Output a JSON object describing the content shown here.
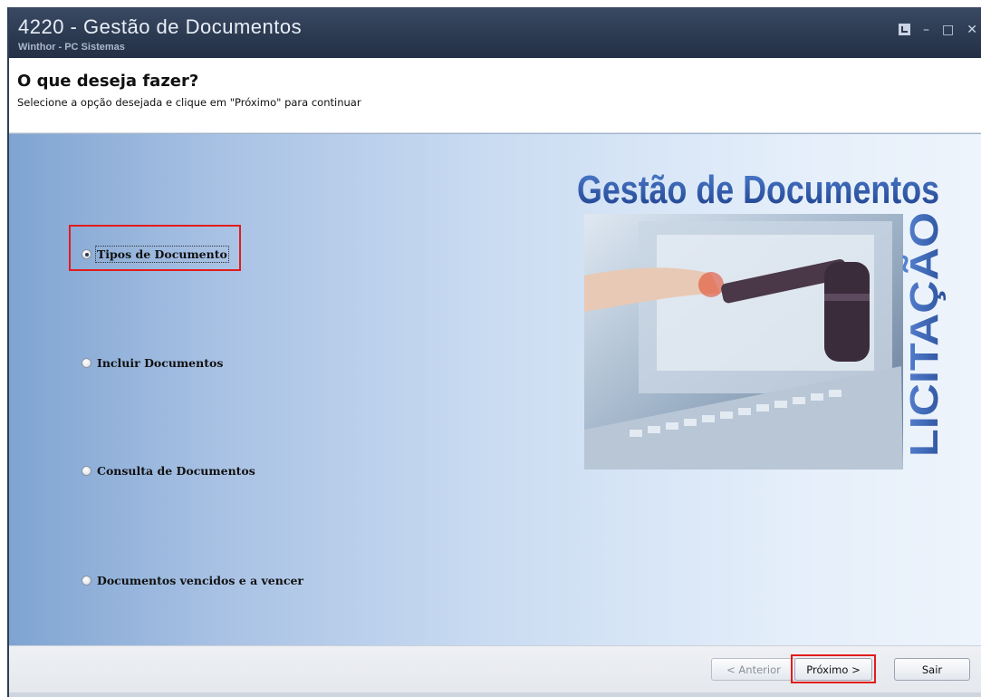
{
  "window": {
    "title": "4220 - Gestão de Documentos",
    "subtitle": "Winthor - PC Sistemas",
    "controls": [
      "restore-icon",
      "minimize-icon",
      "maximize-icon",
      "close-icon"
    ]
  },
  "header": {
    "heading": "O que deseja fazer?",
    "instruction": "Selecione a opção desejada e clique em \"Próximo\" para continuar"
  },
  "options": [
    {
      "label": "Tipos de Documento",
      "checked": true
    },
    {
      "label": "Incluir Documentos",
      "checked": false
    },
    {
      "label": "Consulta de Documentos",
      "checked": false
    },
    {
      "label": "Documentos vencidos e a vencer",
      "checked": false
    }
  ],
  "banner": {
    "title": "Gestão de Documentos",
    "side_text": "LICITAÇÃO"
  },
  "footer": {
    "back": "< Anterior",
    "next": "Próximo >",
    "exit": "Sair"
  },
  "colors": {
    "titlebar": "#2b3950",
    "highlight": "#e21c1c",
    "logo_blue": "#2a4f9a"
  }
}
